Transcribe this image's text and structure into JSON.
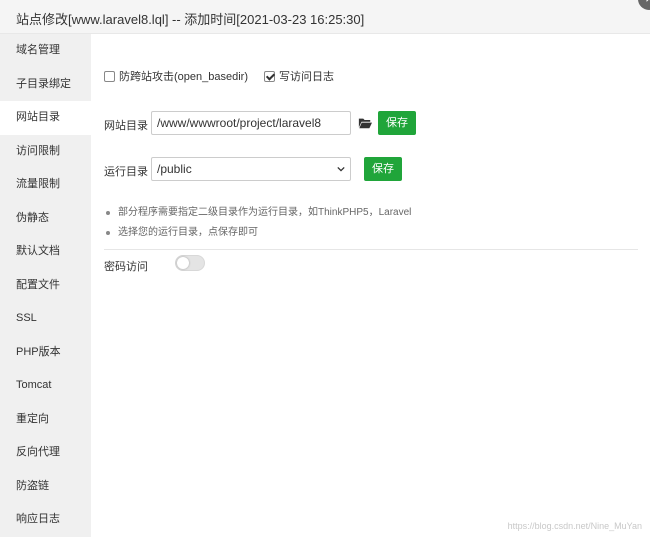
{
  "window": {
    "title": "站点修改[www.laravel8.lql] -- 添加时间[2021-03-23 16:25:30]",
    "close_glyph": "×"
  },
  "sidebar": {
    "items": [
      {
        "label": "域名管理"
      },
      {
        "label": "子目录绑定"
      },
      {
        "label": "网站目录",
        "active": true
      },
      {
        "label": "访问限制"
      },
      {
        "label": "流量限制"
      },
      {
        "label": "伪静态"
      },
      {
        "label": "默认文档"
      },
      {
        "label": "配置文件"
      },
      {
        "label": "SSL"
      },
      {
        "label": "PHP版本"
      },
      {
        "label": "Tomcat"
      },
      {
        "label": "重定向"
      },
      {
        "label": "反向代理"
      },
      {
        "label": "防盗链"
      },
      {
        "label": "响应日志"
      }
    ]
  },
  "options": {
    "anti_cross_site": {
      "label": "防跨站攻击(open_basedir)",
      "checked": false
    },
    "access_log": {
      "label": "写访问日志",
      "checked": true
    }
  },
  "site_dir": {
    "label": "网站目录",
    "value": "/www/wwwroot/project/laravel8",
    "folder_icon": "folder-open-icon",
    "save_label": "保存"
  },
  "run_dir": {
    "label": "运行目录",
    "selected": "/public",
    "save_label": "保存"
  },
  "tips": [
    "部分程序需要指定二级目录作为运行目录，如ThinkPHP5，Laravel",
    "选择您的运行目录，点保存即可"
  ],
  "password_access": {
    "label": "密码访问",
    "enabled": false
  },
  "watermark": "https://blog.csdn.net/Nine_MuYan",
  "colors": {
    "accent": "#20a53a",
    "sidebar_bg": "#f0f0f0",
    "titlebar_bg": "#f5f5f5"
  }
}
